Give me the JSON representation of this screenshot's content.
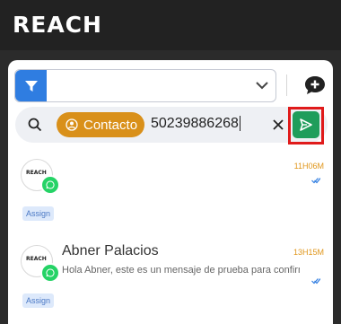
{
  "app": {
    "logo_text": "REACH"
  },
  "filter": {
    "icon": "filter-icon",
    "value": "",
    "chevron": "chevron-down-icon"
  },
  "toolbar": {
    "new_chat_icon": "chat-add-icon"
  },
  "search": {
    "chip_label": "Contacto",
    "chip_icon": "contact-icon",
    "query": "50239886268",
    "clear_icon": "close-icon",
    "send_icon": "send-icon"
  },
  "colors": {
    "accent_blue": "#2f7de1",
    "chip_orange": "#d9901a",
    "send_green": "#1f9d5b",
    "highlight_red": "#e01b1b",
    "time_orange": "#e0961a",
    "whatsapp_green": "#25d366"
  },
  "conversations": [
    {
      "name": "",
      "preview": "",
      "time": "11H06M",
      "assign_label": "Assign",
      "avatar_text": "REACH"
    },
    {
      "name": "Abner Palacios",
      "preview": "Hola Abner, este es un mensaje de prueba para confirmar",
      "time": "13H15M",
      "assign_label": "Assign",
      "avatar_text": "REACH"
    }
  ]
}
